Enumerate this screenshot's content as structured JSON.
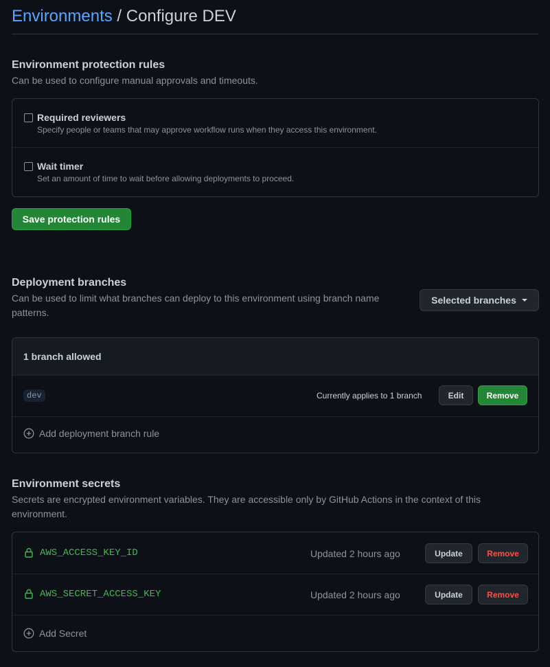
{
  "header": {
    "breadcrumb_link": "Environments",
    "separator": " / ",
    "current": "Configure DEV"
  },
  "protection": {
    "title": "Environment protection rules",
    "description": "Can be used to configure manual approvals and timeouts.",
    "rules": [
      {
        "label": "Required reviewers",
        "note": "Specify people or teams that may approve workflow runs when they access this environment.",
        "checked": false
      },
      {
        "label": "Wait timer",
        "note": "Set an amount of time to wait before allowing deployments to proceed.",
        "checked": false
      }
    ],
    "save_label": "Save protection rules"
  },
  "branches": {
    "title": "Deployment branches",
    "description": "Can be used to limit what branches can deploy to this environment using branch name patterns.",
    "dropdown_label": "Selected branches",
    "box_header": "1 branch allowed",
    "rules": [
      {
        "pattern": "dev",
        "applies": "Currently applies to 1 branch",
        "edit_label": "Edit",
        "remove_label": "Remove"
      }
    ],
    "add_label": "Add deployment branch rule"
  },
  "secrets": {
    "title": "Environment secrets",
    "description": "Secrets are encrypted environment variables. They are accessible only by GitHub Actions in the context of this environment.",
    "items": [
      {
        "name": "AWS_ACCESS_KEY_ID",
        "updated": "Updated 2 hours ago",
        "update_label": "Update",
        "remove_label": "Remove"
      },
      {
        "name": "AWS_SECRET_ACCESS_KEY",
        "updated": "Updated 2 hours ago",
        "update_label": "Update",
        "remove_label": "Remove"
      }
    ],
    "add_label": "Add Secret"
  },
  "colors": {
    "background": "#0d1117",
    "link": "#58a6ff",
    "primary_button": "#238636",
    "danger": "#f85149",
    "secret_name": "#3fb950"
  }
}
